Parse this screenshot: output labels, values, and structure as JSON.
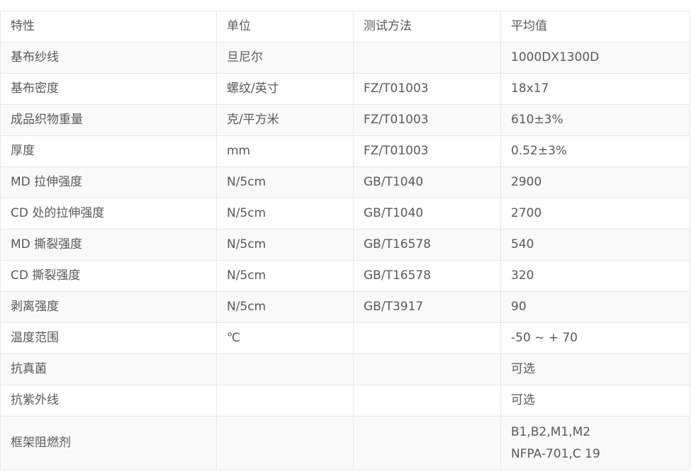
{
  "table": {
    "headers": [
      "特性",
      "单位",
      "测试方法",
      "平均值"
    ],
    "rows": [
      [
        "基布纱线",
        "旦尼尔",
        "",
        "1000DX1300D"
      ],
      [
        "基布密度",
        "螺纹/英寸",
        "FZ/T01003",
        "18x17"
      ],
      [
        "成品织物重量",
        "克/平方米",
        "FZ/T01003",
        "610±3%"
      ],
      [
        "厚度",
        "mm",
        "FZ/T01003",
        "0.52±3%"
      ],
      [
        "MD 拉伸强度",
        "N/5cm",
        "GB/T1040",
        "2900"
      ],
      [
        "CD 处的拉伸强度",
        "N/5cm",
        "GB/T1040",
        "2700"
      ],
      [
        "MD 撕裂强度",
        "N/5cm",
        "GB/T16578",
        "540"
      ],
      [
        "CD 撕裂强度",
        "N/5cm",
        "GB/T16578",
        "320"
      ],
      [
        "剥离强度",
        "N/5cm",
        "GB/T3917",
        "90"
      ],
      [
        "温度范围",
        "℃",
        "",
        "-50 ~ + 70"
      ],
      [
        "抗真菌",
        "",
        "",
        "可选"
      ],
      [
        "抗紫外线",
        "",
        "",
        "可选"
      ]
    ],
    "last_row": {
      "property": "框架阻燃剂",
      "unit": "",
      "method": "",
      "value_line1": "B1,B2,M1,M2",
      "value_line2": "NFPA-701,C 19"
    }
  }
}
